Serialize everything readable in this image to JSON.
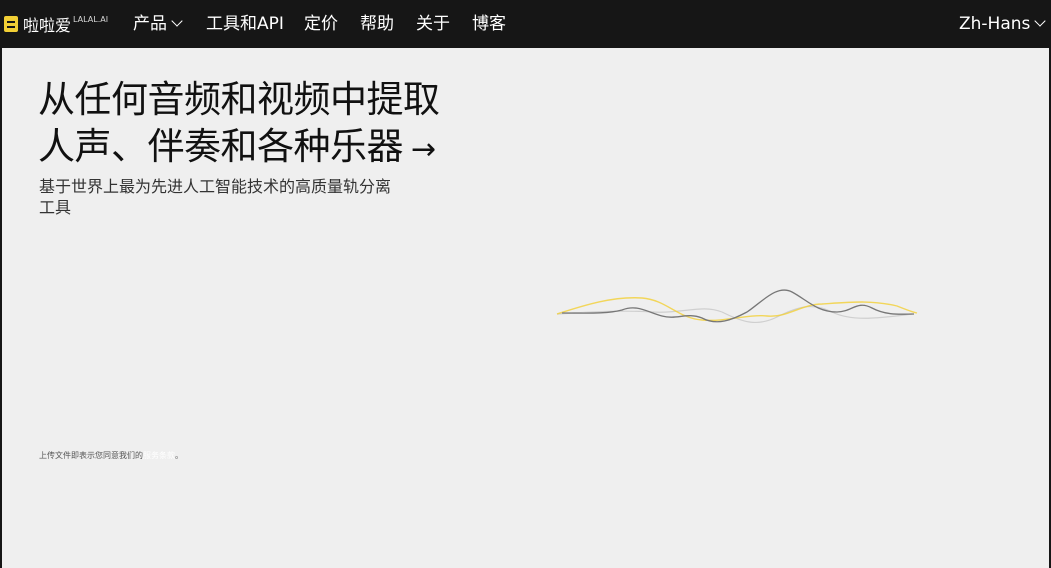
{
  "navbar": {
    "logo_text": "啦啦爱",
    "logo_sup": "LALAL.AI",
    "items": [
      {
        "label": "产品",
        "dropdown": true
      },
      {
        "label": "工具和API",
        "dropdown": false
      },
      {
        "label": "定价",
        "dropdown": false
      },
      {
        "label": "帮助",
        "dropdown": false
      },
      {
        "label": "关于",
        "dropdown": false
      },
      {
        "label": "博客",
        "dropdown": false
      }
    ],
    "language": "Zh-Hans"
  },
  "hero": {
    "title_line1": "从任何音频和视频中提取",
    "title_line2": "人声、伴奏和各种乐器",
    "title_arrow": "→",
    "subtitle": "基于世界上最为先进人工智能技术的高质量轨分离工具"
  },
  "terms": {
    "prefix": "上传文件即表示您同意我们的",
    "link": "服务条款",
    "suffix": "。"
  },
  "colors": {
    "navbar_bg": "#161616",
    "page_bg": "#efefef",
    "accent_yellow": "#f2cf35"
  }
}
